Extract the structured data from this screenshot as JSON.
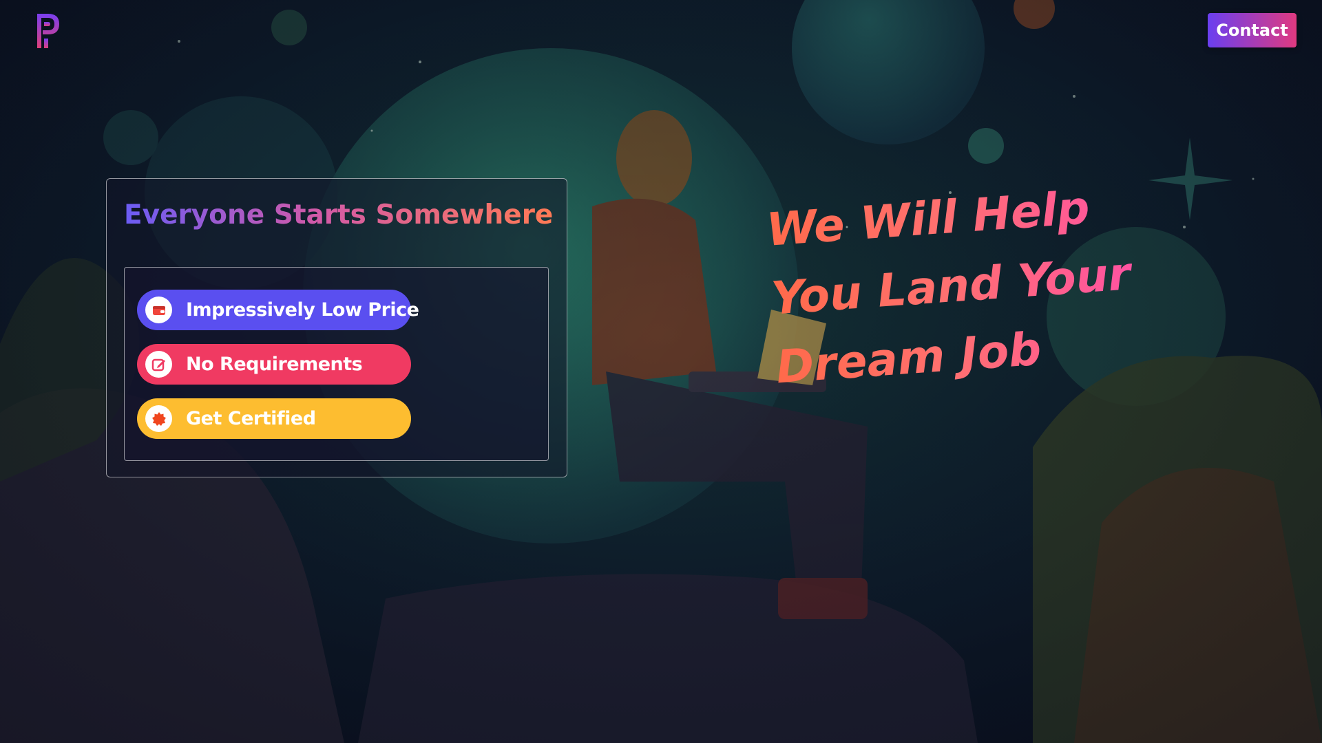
{
  "header": {
    "logo_icon": "brand-p-logo-icon",
    "contact_label": "Contact"
  },
  "card": {
    "title": "Everyone Starts Somewhere",
    "features": [
      {
        "label": "Impressively Low Price",
        "icon": "wallet-icon",
        "color": "#5a4ff0"
      },
      {
        "label": "No Requirements",
        "icon": "edit-icon",
        "color": "#f03a62"
      },
      {
        "label": "Get Certified",
        "icon": "badge-icon",
        "color": "#fdbd30"
      }
    ]
  },
  "hero": {
    "line1": "We Will Help",
    "line2": "You Land Your",
    "line3": "Dream Job"
  },
  "colors": {
    "accent_purple": "#6a3ff0",
    "accent_pink": "#e03a80",
    "headline_orange": "#ff6a4a"
  }
}
